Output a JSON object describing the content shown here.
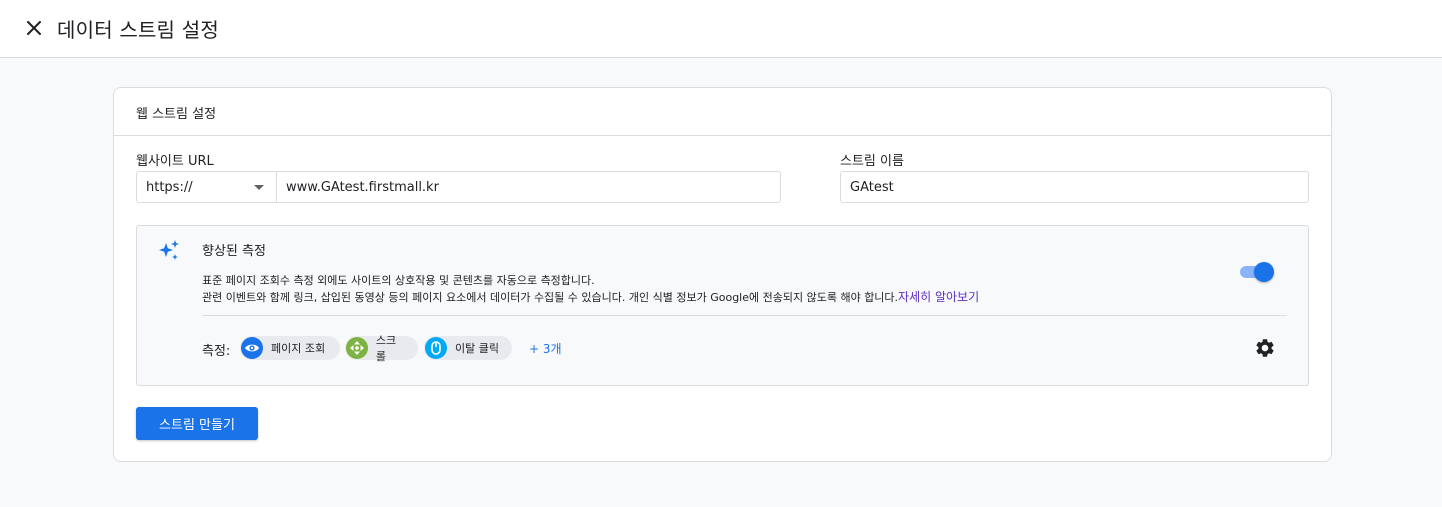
{
  "header": {
    "title": "데이터 스트림 설정",
    "close_icon": "close-icon"
  },
  "card": {
    "title": "웹 스트림 설정",
    "website_url": {
      "label": "웹사이트 URL",
      "protocol": "https://",
      "value": "www.GAtest.firstmall.kr"
    },
    "stream_name": {
      "label": "스트림 이름",
      "value": "GAtest"
    },
    "enhanced_measurement": {
      "icon": "sparkle-icon",
      "title": "향상된 측정",
      "description_line1": "표준 페이지 조회수 측정 외에도 사이트의 상호작용 및 콘텐츠를 자동으로 측정합니다.",
      "description_line2": "관련 이벤트와 함께 링크, 삽입된 동영상 등의 페이지 요소에서 데이터가 수집될 수 있습니다. 개인 식별 정보가 Google에 전송되지 않도록 해야 합니다.",
      "learn_more": "자세히 알아보기",
      "enabled": true,
      "measure_label": "측정:",
      "chips": [
        {
          "label": "페이지 조회",
          "icon": "eye-icon",
          "color": "#1a73e8"
        },
        {
          "label": "스크롤",
          "icon": "scroll-arrows-icon",
          "color": "#7cb342"
        },
        {
          "label": "이탈 클릭",
          "icon": "mouse-icon",
          "color": "#03a9f4"
        }
      ],
      "more": "+ 3개",
      "settings_icon": "gear-icon"
    },
    "create_button": "스트림 만들기"
  },
  "colors": {
    "accent": "#1a73e8",
    "link": "#5c2fc2",
    "border": "#dadce0",
    "background": "#f8f9fa"
  }
}
